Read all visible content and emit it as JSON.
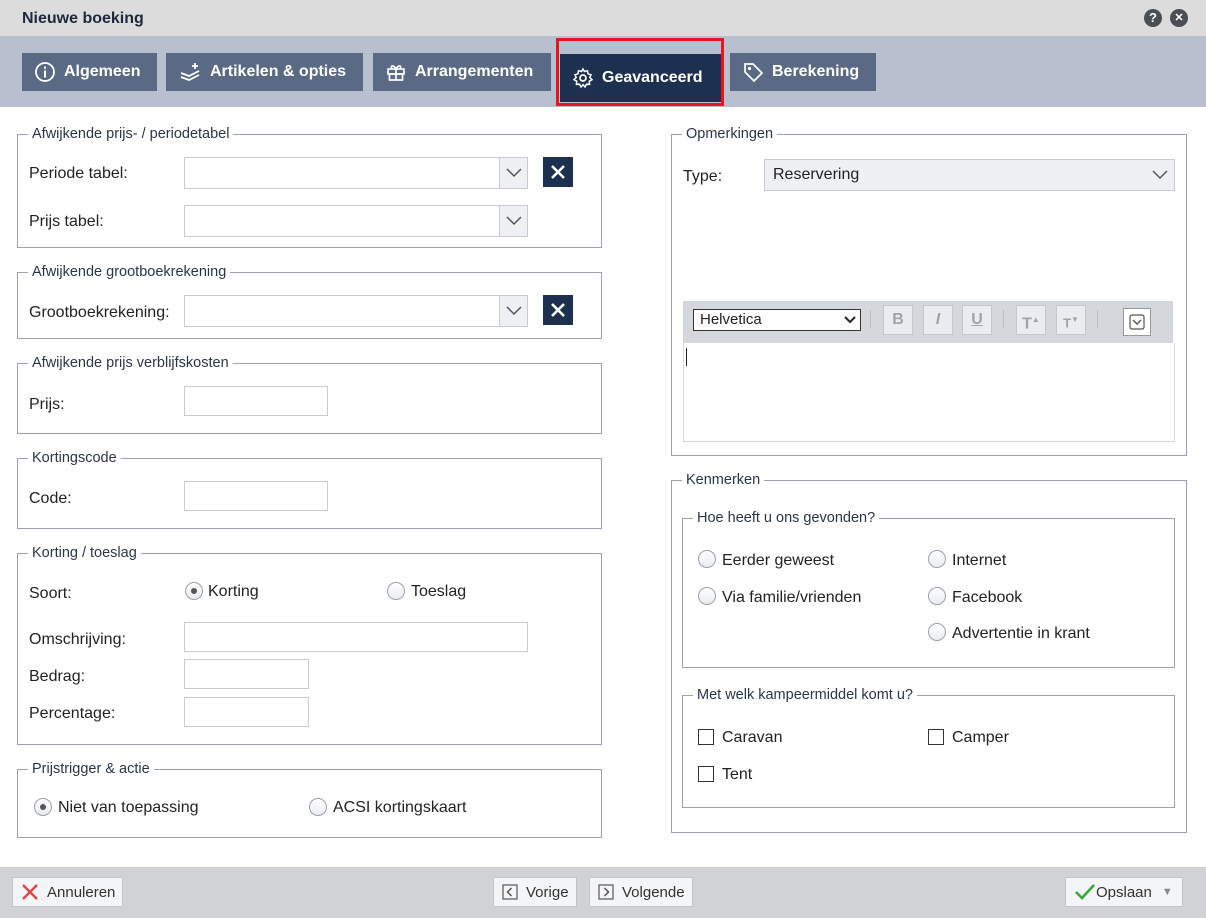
{
  "window": {
    "title": "Nieuwe boeking",
    "help_icon": "?",
    "close_icon": "✕"
  },
  "tabs": [
    {
      "label": "Algemeen",
      "icon": "info-icon"
    },
    {
      "label": "Artikelen & opties",
      "icon": "articles-icon"
    },
    {
      "label": "Arrangementen",
      "icon": "gift-icon"
    },
    {
      "label": "Geavanceerd",
      "icon": "gear-icon",
      "active": true
    },
    {
      "label": "Berekening",
      "icon": "tag-icon"
    }
  ],
  "price_table": {
    "legend": "Afwijkende prijs- / periodetabel",
    "period_label": "Periode tabel:",
    "period_value": "",
    "price_label": "Prijs tabel:",
    "price_value": ""
  },
  "ledger": {
    "legend": "Afwijkende grootboekrekening",
    "label": "Grootboekrekening:",
    "value": ""
  },
  "stay_costs": {
    "legend": "Afwijkende prijs verblijfskosten",
    "label": "Prijs:",
    "value": ""
  },
  "discount_code": {
    "legend": "Kortingscode",
    "label": "Code:",
    "value": ""
  },
  "discount": {
    "legend": "Korting / toeslag",
    "type_label": "Soort:",
    "option_discount": "Korting",
    "option_surcharge": "Toeslag",
    "description_label": "Omschrijving:",
    "amount_label": "Bedrag:",
    "percentage_label": "Percentage:"
  },
  "trigger": {
    "legend": "Prijstrigger & actie",
    "option_none": "Niet van toepassing",
    "option_acsi": "ACSI kortingskaart"
  },
  "remarks": {
    "legend": "Opmerkingen",
    "type_label": "Type:",
    "type_value": "Reservering",
    "font_value": "Helvetica",
    "bold": "B",
    "italic": "I",
    "underline": "U",
    "grow": "T",
    "shrink": "T"
  },
  "features": {
    "legend": "Kenmerken",
    "found": {
      "legend": "Hoe heeft u ons gevonden?",
      "options": [
        "Eerder geweest",
        "Internet",
        "Via familie/vrienden",
        "Facebook",
        "Advertentie in krant"
      ]
    },
    "vehicle": {
      "legend": "Met welk kampeermiddel komt u?",
      "options": [
        "Caravan",
        "Camper",
        "Tent"
      ]
    }
  },
  "footer": {
    "cancel": "Annuleren",
    "previous": "Vorige",
    "next": "Volgende",
    "save": "Opslaan"
  },
  "colors": {
    "accent": "#1e3050",
    "tab": "#5a6a85",
    "highlight": "#e8151b"
  }
}
